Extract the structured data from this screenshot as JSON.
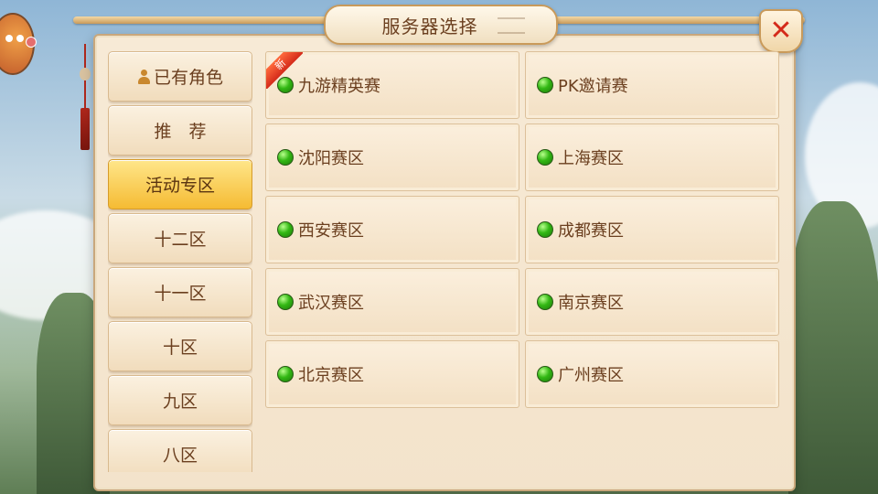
{
  "dialog": {
    "title": "服务器选择",
    "close_label": "✕"
  },
  "sidebar": {
    "items": [
      {
        "label": "已有角色",
        "icon": "person-icon",
        "active": false
      },
      {
        "label": "推　荐",
        "active": false
      },
      {
        "label": "活动专区",
        "active": true
      },
      {
        "label": "十二区",
        "active": false
      },
      {
        "label": "十一区",
        "active": false
      },
      {
        "label": "十区",
        "active": false
      },
      {
        "label": "九区",
        "active": false
      },
      {
        "label": "八区",
        "active": false
      }
    ]
  },
  "servers": [
    {
      "name": "九游精英赛",
      "status": "online",
      "badge": "新"
    },
    {
      "name": "PK邀请赛",
      "status": "online"
    },
    {
      "name": "沈阳赛区",
      "status": "online"
    },
    {
      "name": "上海赛区",
      "status": "online"
    },
    {
      "name": "西安赛区",
      "status": "online"
    },
    {
      "name": "成都赛区",
      "status": "online"
    },
    {
      "name": "武汉赛区",
      "status": "online"
    },
    {
      "name": "南京赛区",
      "status": "online"
    },
    {
      "name": "北京赛区",
      "status": "online"
    },
    {
      "name": "广州赛区",
      "status": "online"
    }
  ],
  "colors": {
    "accent_active": "#f5bb33",
    "status_online": "#33b814",
    "close_red": "#d42a1a"
  }
}
